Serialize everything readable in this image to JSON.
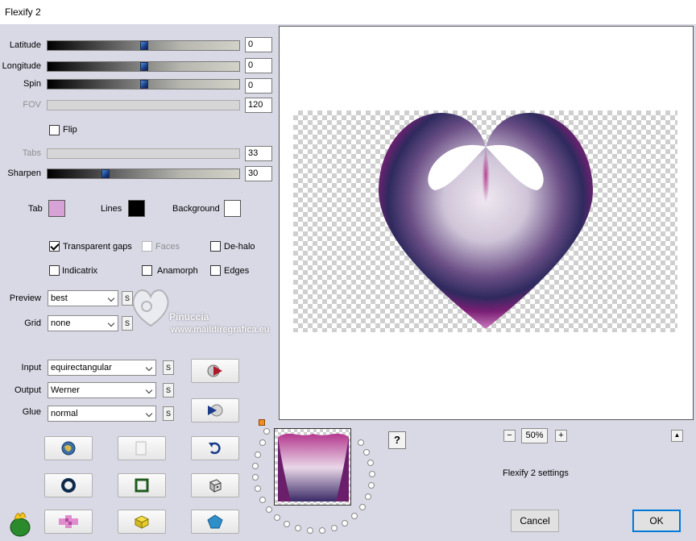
{
  "window": {
    "title": "Flexify 2"
  },
  "sliders": {
    "latitude": {
      "label": "Latitude",
      "value": "0",
      "position": 0.5,
      "enabled": true
    },
    "longitude": {
      "label": "Longitude",
      "value": "0",
      "position": 0.5,
      "enabled": true
    },
    "spin": {
      "label": "Spin",
      "value": "0",
      "position": 0.5,
      "enabled": true
    },
    "fov": {
      "label": "FOV",
      "value": "120",
      "enabled": false
    },
    "tabs": {
      "label": "Tabs",
      "value": "33",
      "enabled": false
    },
    "sharpen": {
      "label": "Sharpen",
      "value": "30",
      "position": 0.3,
      "enabled": true
    }
  },
  "flip": {
    "label": "Flip",
    "checked": false
  },
  "colors": {
    "tab": {
      "label": "Tab",
      "color": "#d7a2d6"
    },
    "lines": {
      "label": "Lines",
      "color": "#000000"
    },
    "background": {
      "label": "Background",
      "color": "#ffffff"
    }
  },
  "options": {
    "transparent_gaps": {
      "label": "Transparent gaps",
      "checked": true
    },
    "faces": {
      "label": "Faces",
      "checked": false,
      "enabled": false
    },
    "de_halo": {
      "label": "De-halo",
      "checked": false
    },
    "indicatrix": {
      "label": "Indicatrix",
      "checked": false
    },
    "anamorph": {
      "label": "Anamorph",
      "checked": false
    },
    "edges": {
      "label": "Edges",
      "checked": false
    }
  },
  "preview_select": {
    "label": "Preview",
    "value": "best",
    "s": "S"
  },
  "grid_select": {
    "label": "Grid",
    "value": "none",
    "s": "S"
  },
  "input_select": {
    "label": "Input",
    "value": "equirectangular",
    "s": "S"
  },
  "output_select": {
    "label": "Output",
    "value": "Werner",
    "s": "S"
  },
  "glue_select": {
    "label": "Glue",
    "value": "normal",
    "s": "S"
  },
  "watermark": {
    "name": "Pinuccia",
    "url": "www.maildiregrafica.eu"
  },
  "zoom": {
    "value": "50%",
    "minus": "−",
    "plus": "+"
  },
  "settings_label": "Flexify 2 settings",
  "help_label": "?",
  "scroll_up_label": "▲",
  "buttons": {
    "cancel": "Cancel",
    "ok": "OK"
  },
  "heart_colors": {
    "light": "#e9d7e8",
    "pink": "#b4388e",
    "purple": "#6b1f6b",
    "navy": "#2e2a5e",
    "grey": "#c9c3d3"
  }
}
